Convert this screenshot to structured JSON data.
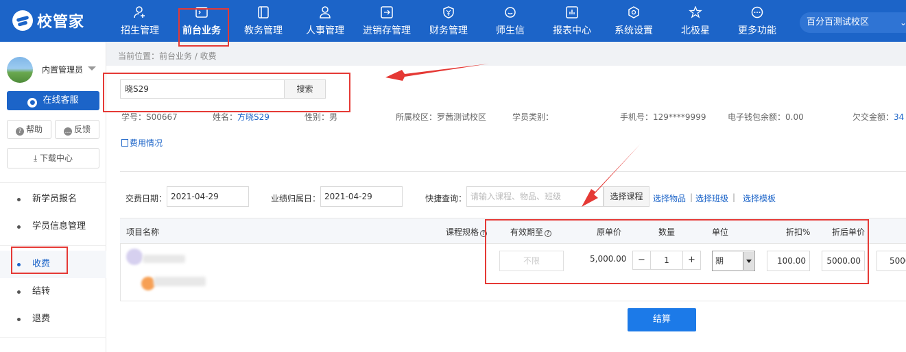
{
  "app": {
    "logo_text": "校管家"
  },
  "nav": {
    "items": [
      {
        "label": "招生管理",
        "icon": "person-add-icon"
      },
      {
        "label": "前台业务",
        "icon": "terminal-icon"
      },
      {
        "label": "教务管理",
        "icon": "book-icon"
      },
      {
        "label": "人事管理",
        "icon": "person-icon"
      },
      {
        "label": "进销存管理",
        "icon": "login-box-icon"
      },
      {
        "label": "财务管理",
        "icon": "yen-shield-icon"
      },
      {
        "label": "师生信",
        "icon": "chat-icon"
      },
      {
        "label": "报表中心",
        "icon": "bar-chart-icon"
      },
      {
        "label": "系统设置",
        "icon": "gear-icon"
      },
      {
        "label": "北极星",
        "icon": "star-icon"
      },
      {
        "label": "更多功能",
        "icon": "more-icon"
      }
    ],
    "campus": "百分百测试校区"
  },
  "sidebar": {
    "user_name": "内置管理员",
    "online_service": "在线客服",
    "help": "帮助",
    "feedback": "反馈",
    "download": "下载中心",
    "menu": [
      {
        "label": "新学员报名"
      },
      {
        "label": "学员信息管理"
      },
      {
        "label": "收费"
      },
      {
        "label": "结转"
      },
      {
        "label": "退费"
      }
    ]
  },
  "breadcrumb": "当前位置：前台业务 / 收费",
  "search": {
    "value": "晓S29",
    "button": "搜索"
  },
  "student": {
    "id_label": "学号：",
    "id": "S00667",
    "name_label": "姓名：",
    "name": "方晓S29",
    "gender_label": "性别：",
    "gender": "男",
    "campus_label": "所属校区：",
    "campus": "罗茜测试校区",
    "type_label": "学员类别：",
    "type": "",
    "phone_label": "手机号：",
    "phone": "129****9999",
    "wallet_label": "电子钱包余额：",
    "wallet": "0.00",
    "owed_label": "欠交金额：",
    "owed": "34"
  },
  "fee_link": "费用情况",
  "form": {
    "pay_date_label": "交费日期：",
    "pay_date": "2021-04-29",
    "perf_date_label": "业绩归属日：",
    "perf_date": "2021-04-29",
    "quick_label": "快捷查询：",
    "quick_placeholder": "请输入课程、物品、班级",
    "select_course": "选择课程",
    "select_goods": "选择物品",
    "select_class": "选择班级",
    "select_template": "选择模板",
    "sep": "|"
  },
  "table": {
    "headers": {
      "item_name": "项目名称",
      "course_spec": "课程规格",
      "valid_until": "有效期至",
      "orig_price": "原单价",
      "qty": "数量",
      "unit": "单位",
      "discount": "折扣%",
      "disc_price": "折后单价"
    },
    "row": {
      "valid_until": "不限",
      "orig_price": "5,000.00",
      "minus": "−",
      "qty": "1",
      "plus": "+",
      "unit": "期",
      "discount": "100.00",
      "disc_price": "5000.00",
      "amount": "5000"
    }
  },
  "settle_button": "结算",
  "colors": {
    "brand": "#1c64c8",
    "annotation": "#e53935"
  }
}
